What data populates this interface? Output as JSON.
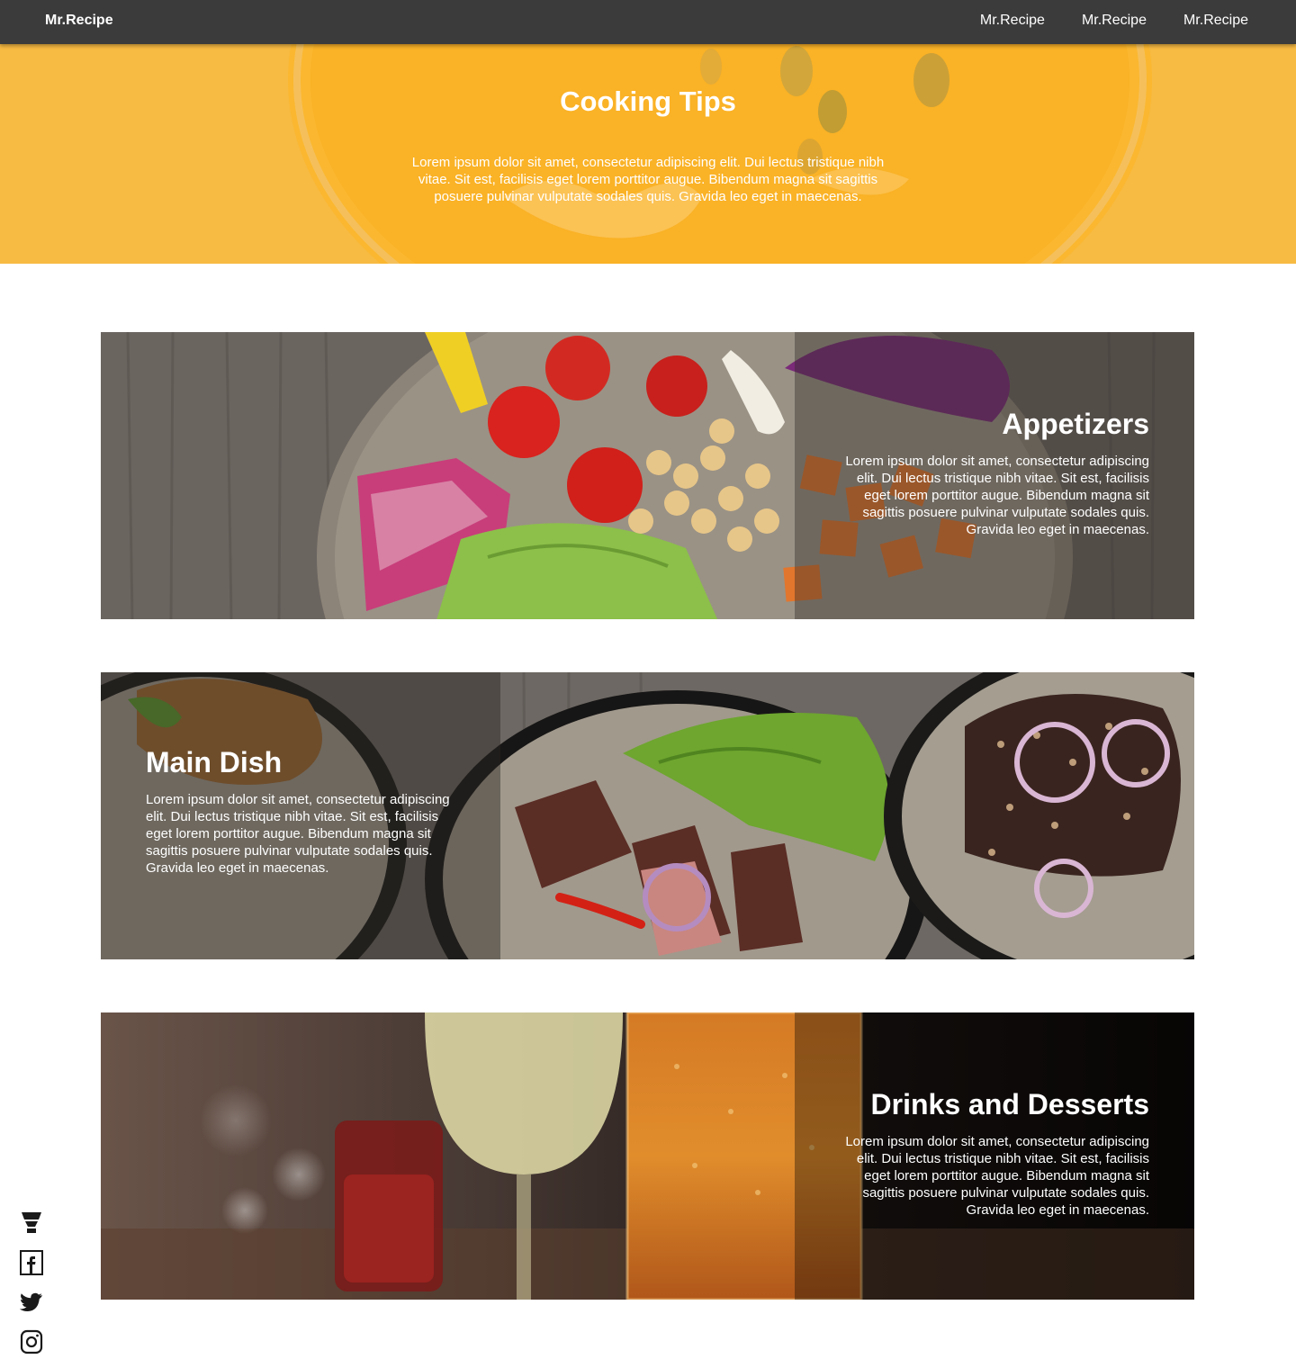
{
  "nav": {
    "brand": "Mr.Recipe",
    "links": [
      "Mr.Recipe",
      "Mr.Recipe",
      "Mr.Recipe"
    ]
  },
  "hero": {
    "title": "Cooking Tips",
    "text": "Lorem ipsum dolor sit amet, consectetur adipiscing elit. Dui lectus tristique nibh vitae. Sit est, facilisis eget lorem porttitor augue. Bibendum magna sit sagittis posuere pulvinar vulputate sodales quis. Gravida leo eget in maecenas."
  },
  "sections": [
    {
      "title": "Appetizers",
      "text": "Lorem ipsum dolor sit amet, consectetur adipiscing elit. Dui lectus tristique nibh vitae. Sit est, facilisis eget lorem porttitor augue. Bibendum magna sit sagittis posuere pulvinar vulputate sodales quis. Gravida leo eget in maecenas."
    },
    {
      "title": "Main Dish",
      "text": "Lorem ipsum dolor sit amet, consectetur adipiscing elit. Dui lectus tristique nibh vitae. Sit est, facilisis eget lorem porttitor augue. Bibendum magna sit sagittis posuere pulvinar vulputate sodales quis. Gravida leo eget in maecenas."
    },
    {
      "title": "Drinks and Desserts",
      "text": "Lorem ipsum dolor sit amet, consectetur adipiscing elit. Dui lectus tristique nibh vitae. Sit est, facilisis eget lorem porttitor augue. Bibendum magna sit sagittis posuere pulvinar vulputate sodales quis. Gravida leo eget in maecenas."
    }
  ],
  "social": [
    "cocktail-icon",
    "facebook-icon",
    "twitter-icon",
    "instagram-icon"
  ],
  "colors": {
    "nav_bg": "#3b3b3b",
    "hero_yellow": "#f8b93a"
  }
}
